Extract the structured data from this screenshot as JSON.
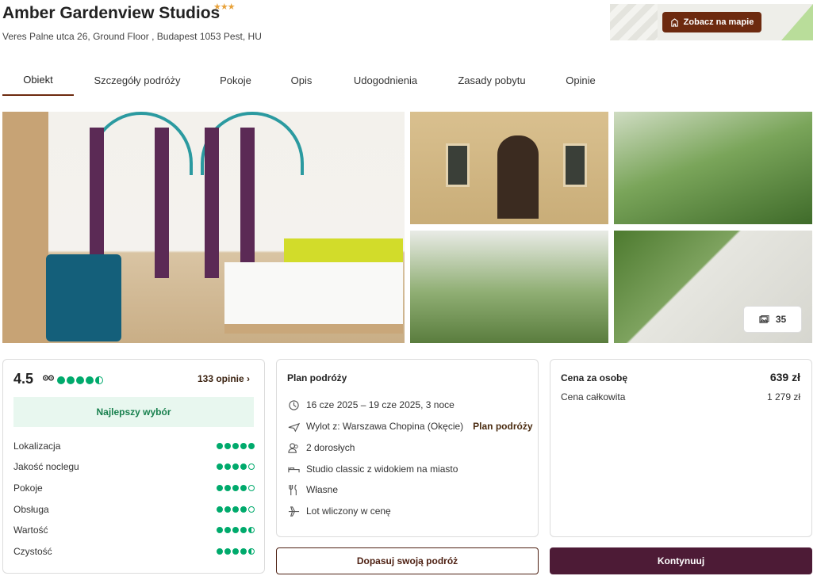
{
  "hotel": {
    "name": "Amber Gardenview Studios",
    "stars": "★★★",
    "address": "Veres Palne utca 26, Ground Floor , Budapest 1053 Pest, HU"
  },
  "map": {
    "button_label": "Zobacz na mapie",
    "icon": "building-icon"
  },
  "tabs": [
    {
      "label": "Obiekt"
    },
    {
      "label": "Szczegóły podróży"
    },
    {
      "label": "Pokoje"
    },
    {
      "label": "Opis"
    },
    {
      "label": "Udogodnienia"
    },
    {
      "label": "Zasady pobytu"
    },
    {
      "label": "Opinie"
    }
  ],
  "gallery": {
    "photo_count": "35"
  },
  "rating": {
    "score": "4.5",
    "score_dots": 4.5,
    "reviews_label": "133 opinie",
    "badge": "Najlepszy wybór",
    "categories": [
      {
        "label": "Lokalizacja",
        "value": 5
      },
      {
        "label": "Jakość noclegu",
        "value": 4
      },
      {
        "label": "Pokoje",
        "value": 4
      },
      {
        "label": "Obsługa",
        "value": 4
      },
      {
        "label": "Wartość",
        "value": 4.5
      },
      {
        "label": "Czystość",
        "value": 4.5
      }
    ]
  },
  "trip": {
    "title": "Plan podróży",
    "dates": "16 cze 2025 – 19 cze 2025, 3 noce",
    "departure": "Wylot z: Warszawa Chopina (Okęcie)",
    "departure_link": "Plan podróży",
    "guests": "2 dorosłych",
    "room": "Studio classic z widokiem na miasto",
    "board": "Własne",
    "flight": "Lot wliczony w cenę"
  },
  "price": {
    "per_person_label": "Cena za osobę",
    "per_person_value": "639 zł",
    "total_label": "Cena całkowita",
    "total_value": "1 279 zł"
  },
  "actions": {
    "customize": "Dopasuj swoją podróż",
    "continue": "Kontynuuj"
  },
  "colors": {
    "brand_brown": "#6d2a0f",
    "primary_button": "#4d1b36",
    "tripadvisor_green": "#00aa6c",
    "badge_bg": "#e8f7ef"
  }
}
